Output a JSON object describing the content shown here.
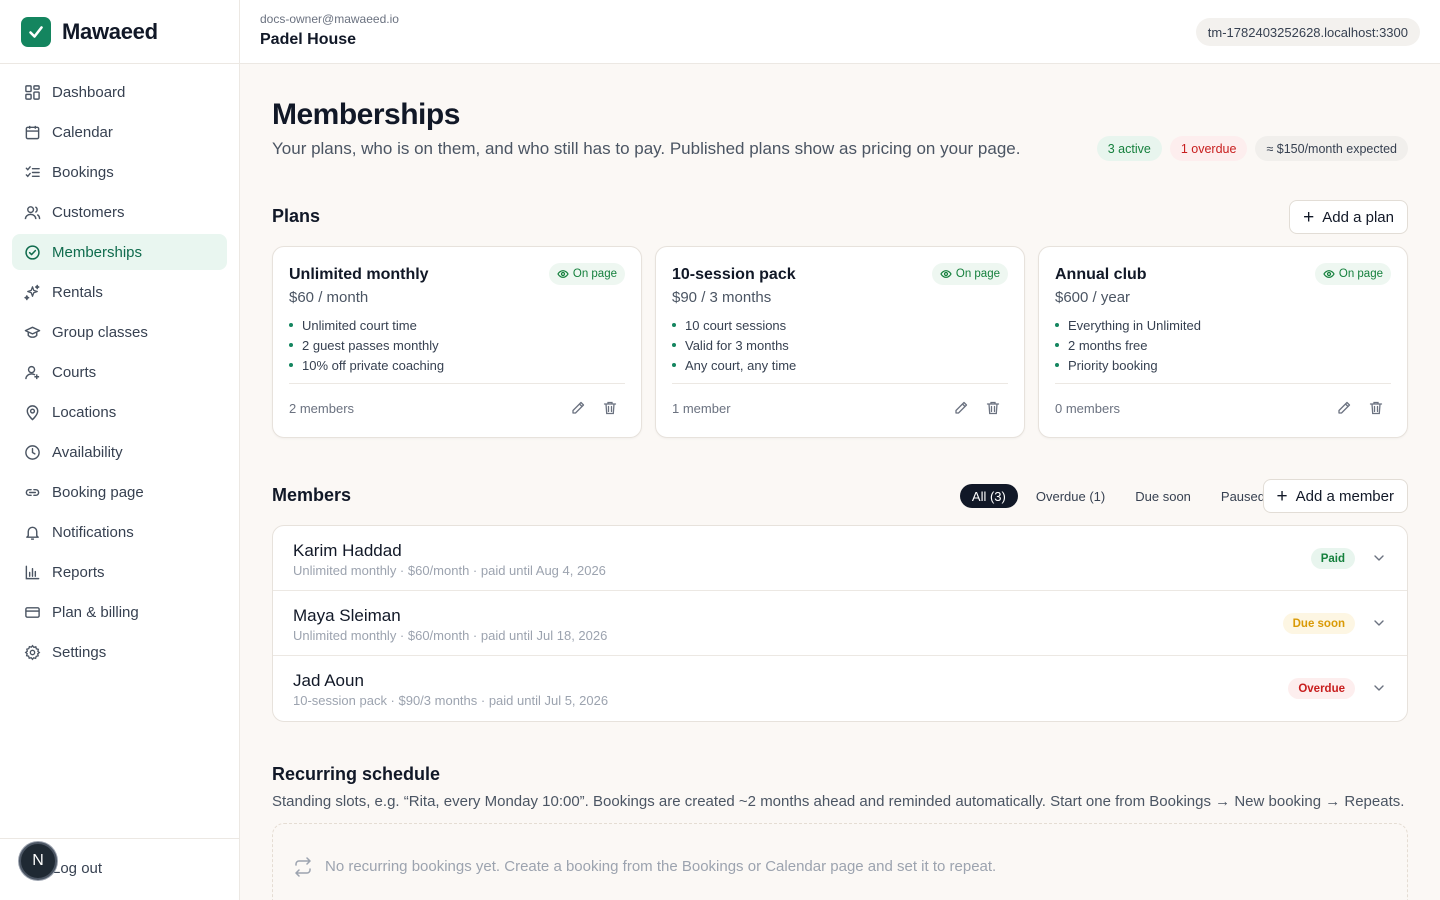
{
  "brand": {
    "name": "Mawaeed",
    "accent": "#14855f"
  },
  "sidebar": {
    "items": [
      {
        "label": "Dashboard",
        "icon": "grid-icon"
      },
      {
        "label": "Calendar",
        "icon": "calendar-icon"
      },
      {
        "label": "Bookings",
        "icon": "list-check-icon"
      },
      {
        "label": "Customers",
        "icon": "users-icon"
      },
      {
        "label": "Memberships",
        "icon": "badge-check-icon",
        "active": true
      },
      {
        "label": "Rentals",
        "icon": "sparkles-icon"
      },
      {
        "label": "Group classes",
        "icon": "graduation-cap-icon"
      },
      {
        "label": "Courts",
        "icon": "user-square-icon"
      },
      {
        "label": "Locations",
        "icon": "map-pin-icon"
      },
      {
        "label": "Availability",
        "icon": "clock-icon"
      },
      {
        "label": "Booking page",
        "icon": "link-icon"
      },
      {
        "label": "Notifications",
        "icon": "bell-icon"
      },
      {
        "label": "Reports",
        "icon": "bar-chart-icon"
      },
      {
        "label": "Plan & billing",
        "icon": "credit-card-icon"
      },
      {
        "label": "Settings",
        "icon": "gear-icon"
      }
    ],
    "logout_label": "Log out",
    "avatar_initial": "N"
  },
  "topbar": {
    "email": "docs-owner@mawaeed.io",
    "business": "Padel House",
    "host": "tm-1782403252628.localhost:3300"
  },
  "page": {
    "title": "Memberships",
    "subtitle": "Your plans, who is on them, and who still has to pay. Published plans show as pricing on your page.",
    "stats": {
      "active": "3 active",
      "overdue": "1 overdue",
      "expected": "≈ $150/month expected"
    }
  },
  "plans": {
    "title": "Plans",
    "add_label": "Add a plan",
    "on_page_label": "On page",
    "items": [
      {
        "name": "Unlimited monthly",
        "price": "$60 / month",
        "features": [
          "Unlimited court time",
          "2 guest passes monthly",
          "10% off private coaching"
        ],
        "members": "2 members"
      },
      {
        "name": "10-session pack",
        "price": "$90 / 3 months",
        "features": [
          "10 court sessions",
          "Valid for 3 months",
          "Any court, any time"
        ],
        "members": "1 member"
      },
      {
        "name": "Annual club",
        "price": "$600 / year",
        "features": [
          "Everything in Unlimited",
          "2 months free",
          "Priority booking"
        ],
        "members": "0 members"
      }
    ]
  },
  "members": {
    "title": "Members",
    "filters": [
      "All (3)",
      "Overdue (1)",
      "Due soon",
      "Paused"
    ],
    "add_label": "Add a member",
    "rows": [
      {
        "name": "Karim Haddad",
        "detail": "Unlimited monthly · $60/month · paid until Aug 4, 2026",
        "status": "Paid",
        "status_kind": "paid"
      },
      {
        "name": "Maya Sleiman",
        "detail": "Unlimited monthly · $60/month · paid until Jul 18, 2026",
        "status": "Due soon",
        "status_kind": "due"
      },
      {
        "name": "Jad Aoun",
        "detail": "10-session pack · $90/3 months · paid until Jul 5, 2026",
        "status": "Overdue",
        "status_kind": "overdue"
      }
    ]
  },
  "recurring": {
    "title": "Recurring schedule",
    "description": "Standing slots, e.g. “Rita, every Monday 10:00”. Bookings are created ~2 months ahead and reminded automatically. Start one from Bookings → New booking → Repeats.",
    "empty": "No recurring bookings yet. Create a booking from the Bookings or Calendar page and set it to repeat."
  }
}
